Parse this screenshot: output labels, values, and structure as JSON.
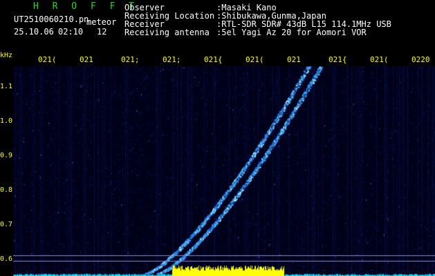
{
  "header": {
    "logo": "H R O F F T",
    "filename": "UT2510060210.pn",
    "event_type": "meteor",
    "date": "25.10.06",
    "time": "02:10",
    "count": "12",
    "observer_label": "Observer",
    "observer_value": ":Masaki Kano",
    "location_label": "Receiving Location",
    "location_value": ":Shibukawa,Gunma,Japan",
    "receiver_label": "Receiver",
    "receiver_value": ":RTL-SDR SDR# 43dB L15 114.1MHz USB",
    "antenna_label": "Receiving antenna",
    "antenna_value": ":5el Yagi Az 20 for Aomori VOR"
  },
  "x_ticks": [
    "021(",
    "021",
    "021;",
    "021;",
    "021{",
    "021(",
    "021",
    "021{",
    "021(",
    "0220"
  ],
  "y_unit": "kHz",
  "y_ticks": [
    "1.1",
    "1.0",
    "0.9",
    "0.8",
    "0.7",
    "0.6"
  ],
  "colors": {
    "background": "#000000",
    "header_text": "#ffffff",
    "logo": "#22dd22",
    "ticks": "#ffff00",
    "signal": "#3fb6ff",
    "baseline": "#00e5ff",
    "burst": "#ffff00"
  }
}
